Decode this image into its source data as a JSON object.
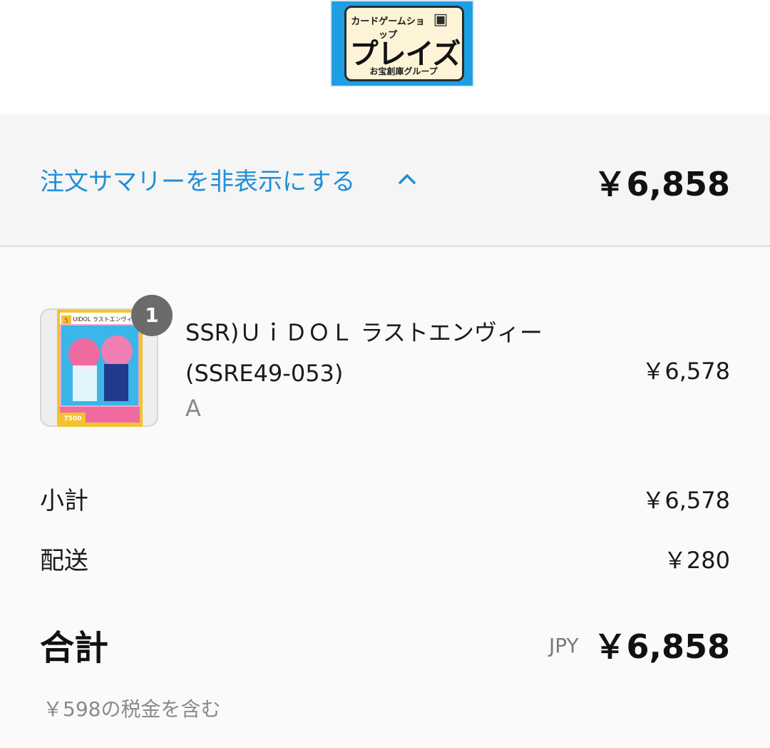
{
  "logo": {
    "top_text": "カードゲームショップ",
    "main_text": "プレイズ",
    "sub_text": "お宝創庫グループ",
    "bg_color": "#1e9fe3"
  },
  "summary_toggle": {
    "label": "注文サマリーを非表示にする",
    "icon": "chevron-up-icon",
    "total": "￥6,858",
    "accent_color": "#1f8fd6"
  },
  "line_items": [
    {
      "quantity": "1",
      "name_line1": "SSR)ＵｉＤＯＬ ラストエンヴィー",
      "name_line2": "(SSRE49-053)",
      "variant": "A",
      "price": "￥6,578"
    }
  ],
  "card_image": {
    "cost": "5",
    "title": "UiDOL ラストエンヴィー",
    "power": "7500"
  },
  "totals": {
    "subtotal_label": "小計",
    "subtotal_value": "￥6,578",
    "shipping_label": "配送",
    "shipping_value": "￥280",
    "total_label": "合計",
    "currency": "JPY",
    "total_value": "￥6,858",
    "tax_note": "￥598の税金を含む"
  }
}
